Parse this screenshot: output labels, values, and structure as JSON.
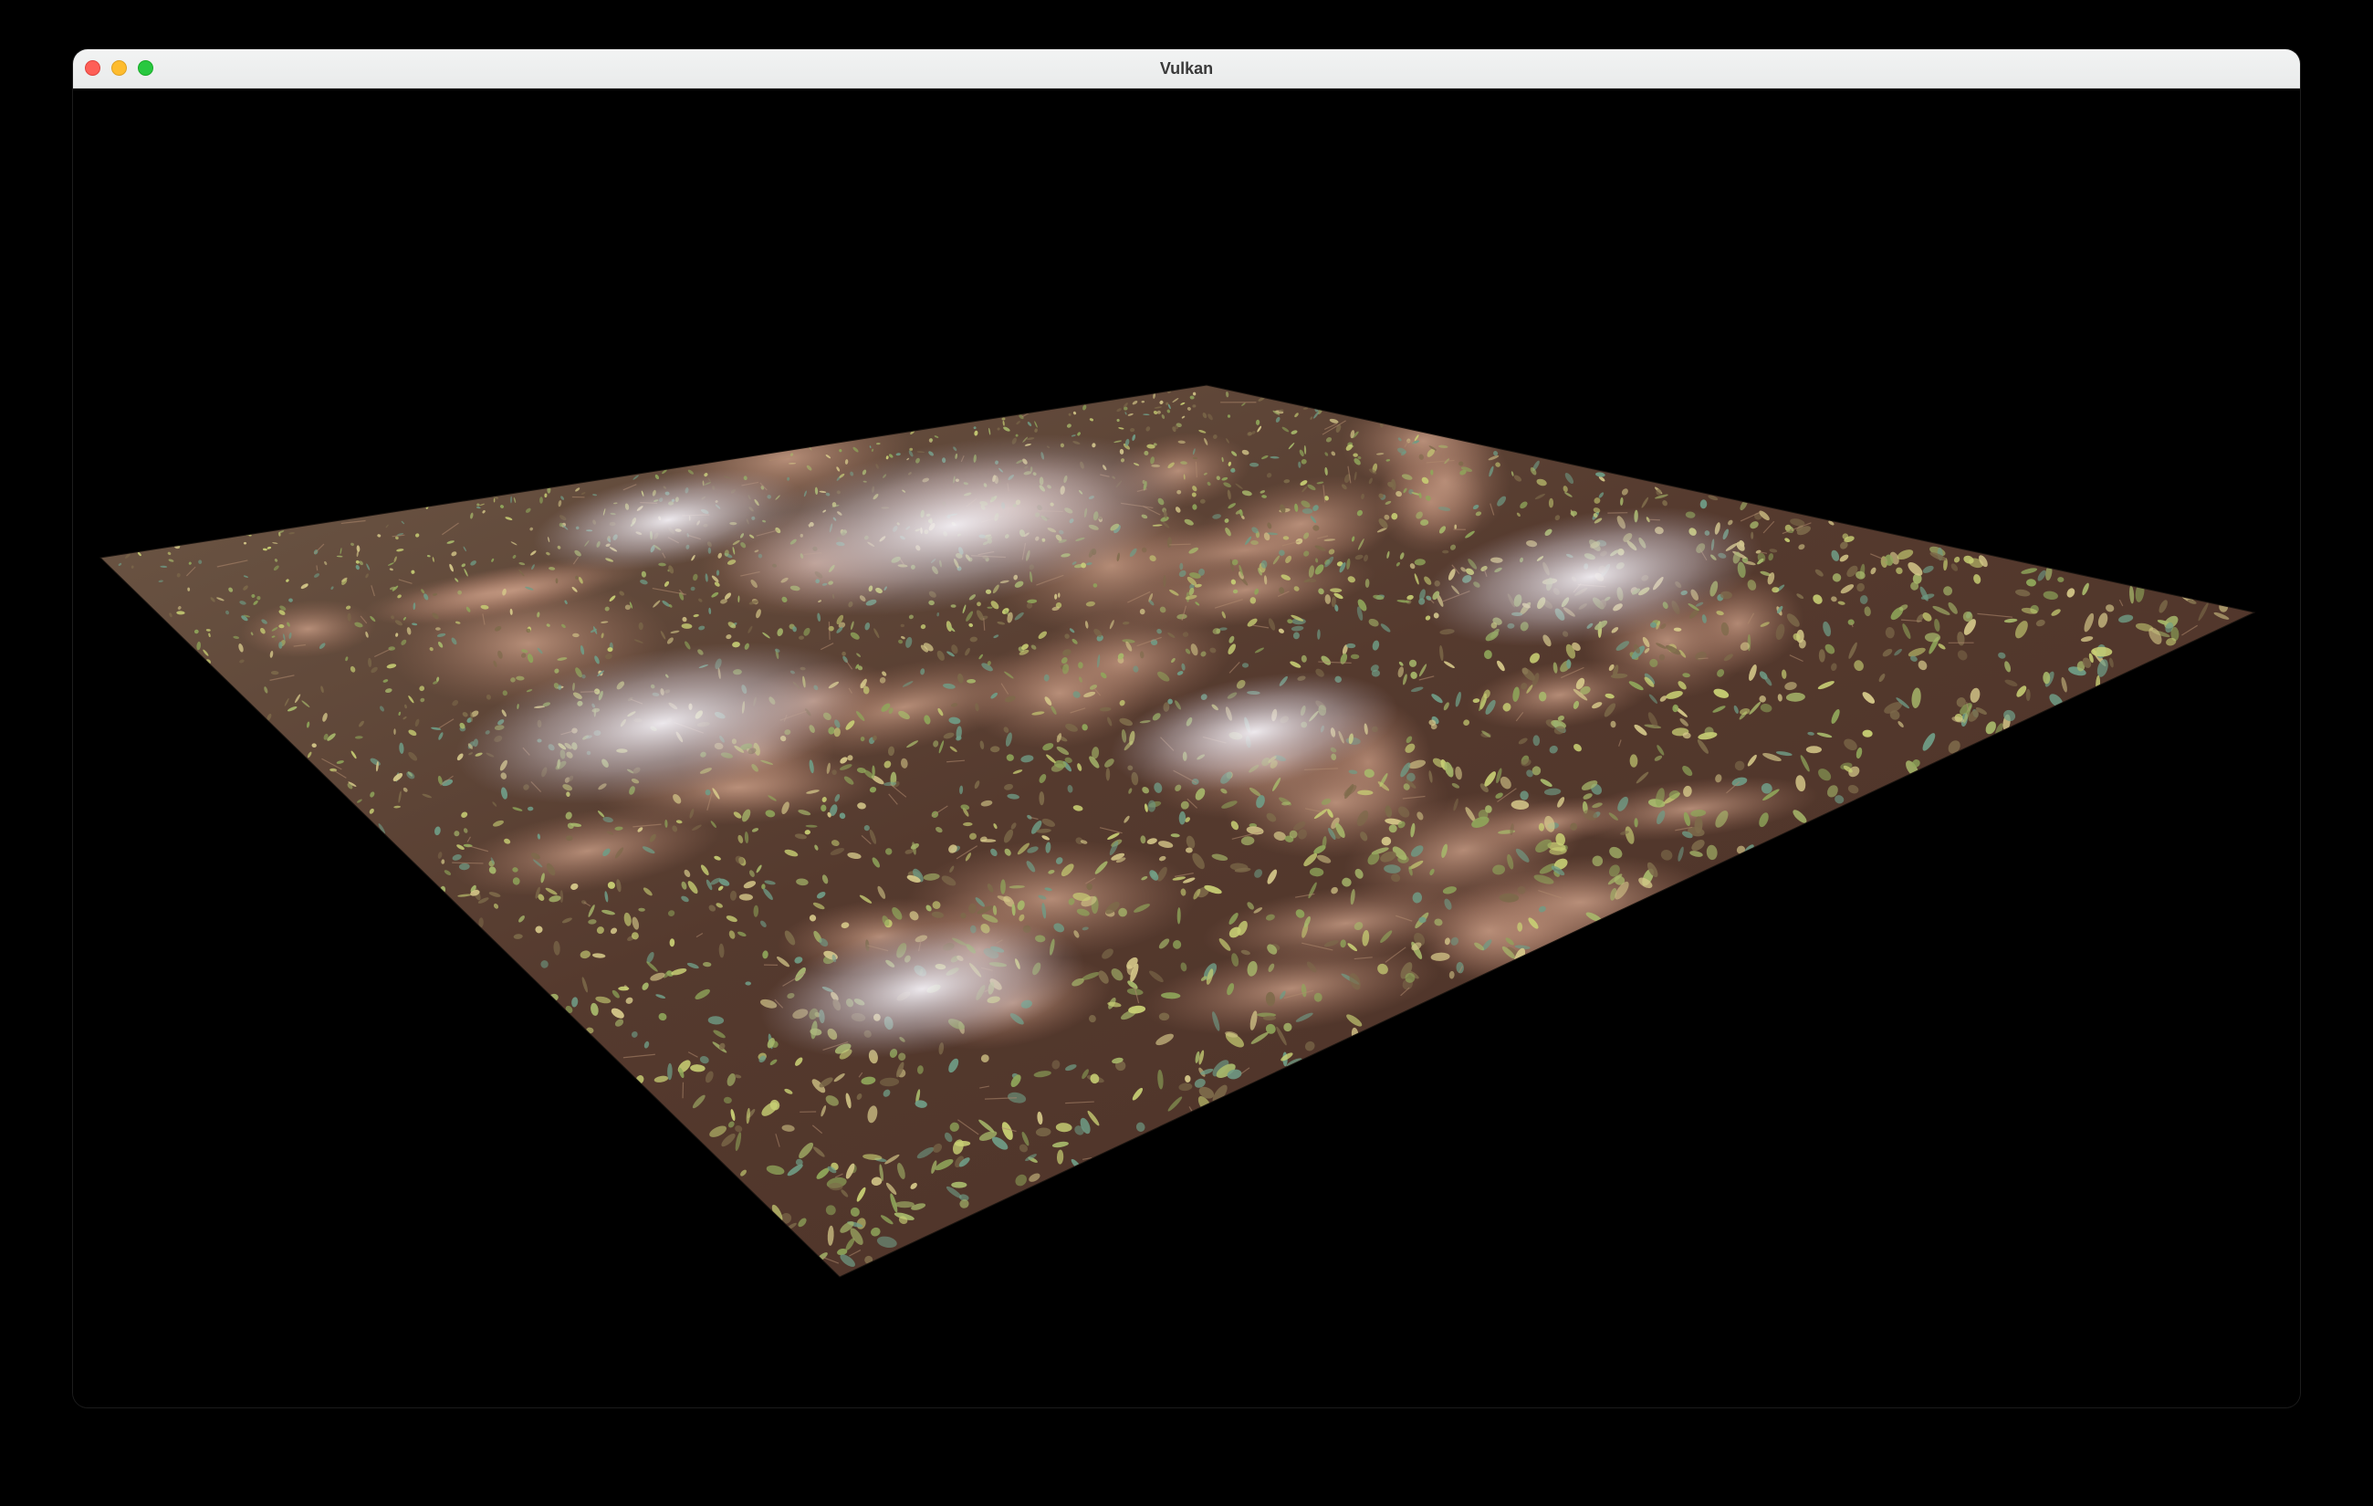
{
  "window": {
    "title": "Vulkan",
    "controls": {
      "close_color": "#fe5f57",
      "minimize_color": "#febc2e",
      "zoom_color": "#28c840"
    }
  },
  "scene": {
    "description_icon": "textured-ground-plane",
    "palette": {
      "soil": "#5b3a2c",
      "clay": "#b98a74",
      "leaf_light": "#c8cf74",
      "leaf_mid": "#8fa65a",
      "leaf_teal": "#6f9c86",
      "specular": "#e8e4ea"
    }
  }
}
